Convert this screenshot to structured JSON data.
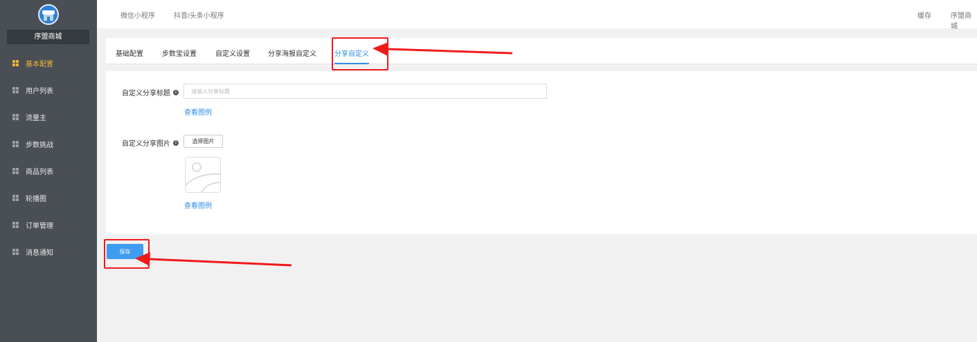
{
  "sidebar": {
    "store_name": "序盟商城",
    "items": [
      {
        "label": "基本配置",
        "active": true
      },
      {
        "label": "用户列表",
        "active": false
      },
      {
        "label": "流量主",
        "active": false
      },
      {
        "label": "步数挑战",
        "active": false
      },
      {
        "label": "商品列表",
        "active": false
      },
      {
        "label": "轮播图",
        "active": false
      },
      {
        "label": "订单管理",
        "active": false
      },
      {
        "label": "消息通知",
        "active": false
      }
    ]
  },
  "topbar": {
    "links": [
      "微信小程序",
      "抖音/头条小程序"
    ],
    "cache": "缓存",
    "store": "序盟商城"
  },
  "tabs": [
    {
      "label": "基础配置"
    },
    {
      "label": "步数宝设置"
    },
    {
      "label": "自定义设置"
    },
    {
      "label": "分享海报自定义"
    },
    {
      "label": "分享自定义",
      "active": true
    }
  ],
  "form": {
    "title_label": "自定义分享标题",
    "title_placeholder": "请输入分享标题",
    "title_value": "",
    "view_example": "查看图例",
    "image_label": "自定义分享图片",
    "select_image": "选择图片",
    "view_example_2": "查看图例"
  },
  "save_label": "保存",
  "colors": {
    "sidebar_bg": "#4a4f55",
    "active_nav": "#f0b63a",
    "link_blue": "#2f8de4",
    "primary_button": "#3f9cf0",
    "annotation_red": "#f01a1a"
  }
}
